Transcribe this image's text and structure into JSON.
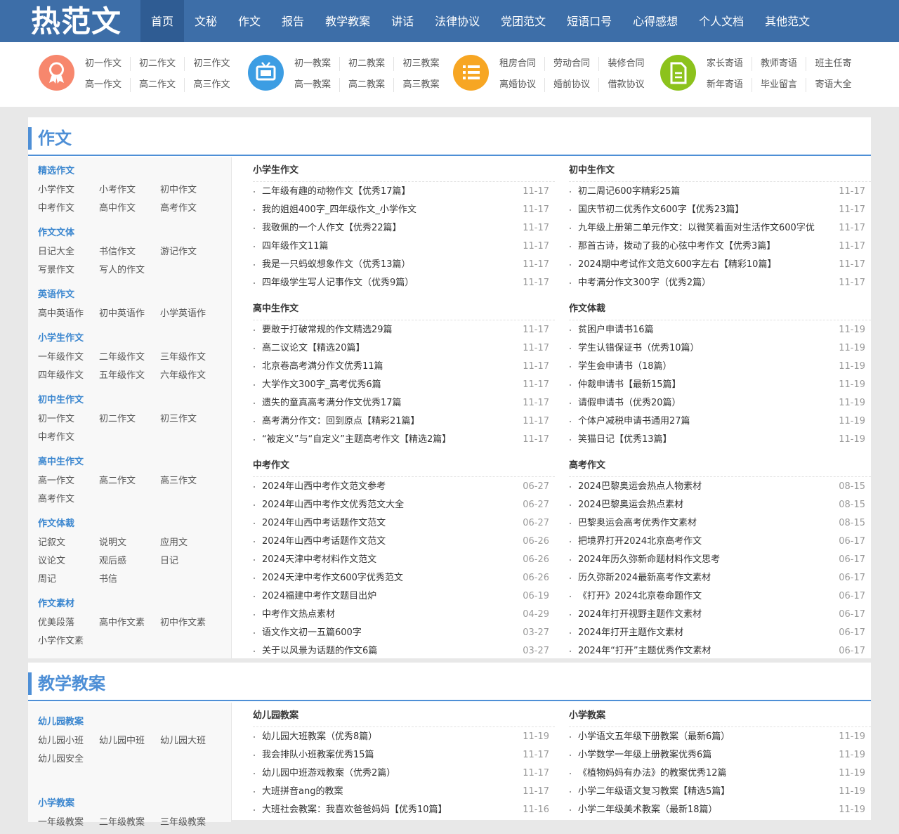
{
  "header": {
    "logo": "热范文",
    "nav": [
      "首页",
      "文秘",
      "作文",
      "报告",
      "教学教案",
      "讲话",
      "法律协议",
      "党团范文",
      "短语口号",
      "心得感想",
      "个人文档",
      "其他范文"
    ],
    "active_nav_index": 0
  },
  "quicklinks": [
    {
      "icon": "award-ribbon-icon",
      "color": "#f7876d",
      "rows": [
        [
          "初一作文",
          "初二作文",
          "初三作文"
        ],
        [
          "高一作文",
          "高二作文",
          "高三作文"
        ]
      ]
    },
    {
      "icon": "tv-icon",
      "color": "#3c9de3",
      "rows": [
        [
          "初一教案",
          "初二教案",
          "初三教案"
        ],
        [
          "高一教案",
          "高二教案",
          "高三教案"
        ]
      ]
    },
    {
      "icon": "list-icon",
      "color": "#f7a623",
      "rows": [
        [
          "租房合同",
          "劳动合同",
          "装修合同"
        ],
        [
          "离婚协议",
          "婚前协议",
          "借款协议"
        ]
      ]
    },
    {
      "icon": "document-icon",
      "color": "#8cc21c",
      "rows": [
        [
          "家长寄语",
          "教师寄语",
          "班主任寄"
        ],
        [
          "新年寄语",
          "毕业留言",
          "寄语大全"
        ]
      ]
    }
  ],
  "sections": [
    {
      "title": "作文",
      "sidebar": [
        {
          "title": "精选作文",
          "items": [
            "小学作文",
            "小考作文",
            "初中作文",
            "中考作文",
            "高中作文",
            "高考作文"
          ]
        },
        {
          "title": "作文文体",
          "items": [
            "日记大全",
            "书信作文",
            "游记作文",
            "写景作文",
            "写人的作文"
          ]
        },
        {
          "title": "英语作文",
          "items": [
            "高中英语作",
            "初中英语作",
            "小学英语作"
          ]
        },
        {
          "title": "小学生作文",
          "items": [
            "一年级作文",
            "二年级作文",
            "三年级作文",
            "四年级作文",
            "五年级作文",
            "六年级作文"
          ]
        },
        {
          "title": "初中生作文",
          "items": [
            "初一作文",
            "初二作文",
            "初三作文",
            "中考作文"
          ]
        },
        {
          "title": "高中生作文",
          "items": [
            "高一作文",
            "高二作文",
            "高三作文",
            "高考作文"
          ]
        },
        {
          "title": "作文体裁",
          "items": [
            "记叙文",
            "说明文",
            "应用文",
            "议论文",
            "观后感",
            "日记",
            "周记",
            "书信"
          ]
        },
        {
          "title": "作文素材",
          "items": [
            "优美段落",
            "高中作文素",
            "初中作文素",
            "小学作文素"
          ]
        }
      ],
      "columns": [
        [
          {
            "title": "小学生作文",
            "items": [
              [
                "二年级有趣的动物作文【优秀17篇】",
                "11-17"
              ],
              [
                "我的姐姐400字_四年级作文_小学作文",
                "11-17"
              ],
              [
                "我敬佩的一个人作文【优秀22篇】",
                "11-17"
              ],
              [
                "四年级作文11篇",
                "11-17"
              ],
              [
                "我是一只蚂蚁想象作文（优秀13篇）",
                "11-17"
              ],
              [
                "四年级学生写人记事作文（优秀9篇）",
                "11-17"
              ]
            ]
          },
          {
            "title": "高中生作文",
            "items": [
              [
                "要敢于打破常规的作文精选29篇",
                "11-17"
              ],
              [
                "高二议论文【精选20篇】",
                "11-17"
              ],
              [
                "北京卷高考满分作文优秀11篇",
                "11-17"
              ],
              [
                "大学作文300字_高考优秀6篇",
                "11-17"
              ],
              [
                "遗失的童真高考满分作文优秀17篇",
                "11-17"
              ],
              [
                "高考满分作文：回到原点【精彩21篇】",
                "11-17"
              ],
              [
                "“被定义”与“自定义”主题高考作文【精选2篇】",
                "11-17"
              ]
            ]
          },
          {
            "title": "中考作文",
            "items": [
              [
                "2024年山西中考作文范文参考",
                "06-27"
              ],
              [
                "2024年山西中考作文优秀范文大全",
                "06-27"
              ],
              [
                "2024年山西中考话题作文范文",
                "06-27"
              ],
              [
                "2024年山西中考话题作文范文",
                "06-26"
              ],
              [
                "2024天津中考材料作文范文",
                "06-26"
              ],
              [
                "2024天津中考作文600字优秀范文",
                "06-26"
              ],
              [
                "2024福建中考作文题目出炉",
                "06-19"
              ],
              [
                "中考作文热点素材",
                "04-29"
              ],
              [
                "语文作文初一五篇600字",
                "03-27"
              ],
              [
                "关于以风景为话题的作文6篇",
                "03-27"
              ]
            ]
          }
        ],
        [
          {
            "title": "初中生作文",
            "items": [
              [
                "初二周记600字精彩25篇",
                "11-17"
              ],
              [
                "国庆节初二优秀作文600字【优秀23篇】",
                "11-17"
              ],
              [
                "九年级上册第二单元作文：以微笑着面对生活作文600字优",
                "11-17"
              ],
              [
                "那首古诗，拨动了我的心弦中考作文【优秀3篇】",
                "11-17"
              ],
              [
                "2024期中考试作文范文600字左右【精彩10篇】",
                "11-17"
              ],
              [
                "中考满分作文300字（优秀2篇）",
                "11-17"
              ]
            ]
          },
          {
            "title": "作文体裁",
            "items": [
              [
                "贫困户申请书16篇",
                "11-19"
              ],
              [
                "学生认错保证书（优秀10篇）",
                "11-19"
              ],
              [
                "学生会申请书（18篇）",
                "11-19"
              ],
              [
                "仲裁申请书【最新15篇】",
                "11-19"
              ],
              [
                "请假申请书（优秀20篇）",
                "11-19"
              ],
              [
                "个体户减税申请书通用27篇",
                "11-19"
              ],
              [
                "笑猫日记【优秀13篇】",
                "11-19"
              ]
            ]
          },
          {
            "title": "高考作文",
            "items": [
              [
                "2024巴黎奥运会热点人物素材",
                "08-15"
              ],
              [
                "2024巴黎奥运会热点素材",
                "08-15"
              ],
              [
                "巴黎奥运会高考优秀作文素材",
                "08-15"
              ],
              [
                "把境界打开2024北京高考作文",
                "06-17"
              ],
              [
                "2024年历久弥新命题材料作文思考",
                "06-17"
              ],
              [
                "历久弥新2024最新高考作文素材",
                "06-17"
              ],
              [
                "《打开》2024北京卷命题作文",
                "06-17"
              ],
              [
                "2024年打开视野主题作文素材",
                "06-17"
              ],
              [
                "2024年打开主题作文素材",
                "06-17"
              ],
              [
                "2024年“打开”主题优秀作文素材",
                "06-17"
              ]
            ]
          }
        ]
      ]
    },
    {
      "title": "教学教案",
      "sidebar": [
        {
          "title": "幼儿园教案",
          "items": [
            "幼儿园小班",
            "幼儿园中班",
            "幼儿园大班",
            "幼儿园安全"
          ]
        },
        {
          "title": "小学教案",
          "items": [
            "一年级教案",
            "二年级教案",
            "三年级教案"
          ]
        }
      ],
      "columns": [
        [
          {
            "title": "幼儿园教案",
            "items": [
              [
                "幼儿园大班教案（优秀8篇）",
                "11-19"
              ],
              [
                "我会排队小班教案优秀15篇",
                "11-17"
              ],
              [
                "幼儿园中班游戏教案（优秀2篇）",
                "11-17"
              ],
              [
                "大班拼音ang的教案",
                "11-17"
              ],
              [
                "大班社会教案：我喜欢爸爸妈妈【优秀10篇】",
                "11-16"
              ]
            ]
          }
        ],
        [
          {
            "title": "小学教案",
            "items": [
              [
                "小学语文五年级下册教案（最新6篇）",
                "11-19"
              ],
              [
                "小学数学一年级上册教案优秀6篇",
                "11-19"
              ],
              [
                "《植物妈妈有办法》的教案优秀12篇",
                "11-19"
              ],
              [
                "小学二年级语文复习教案【精选5篇】",
                "11-19"
              ],
              [
                "小学二年级美术教案（最新18篇）",
                "11-19"
              ]
            ]
          }
        ]
      ]
    }
  ]
}
